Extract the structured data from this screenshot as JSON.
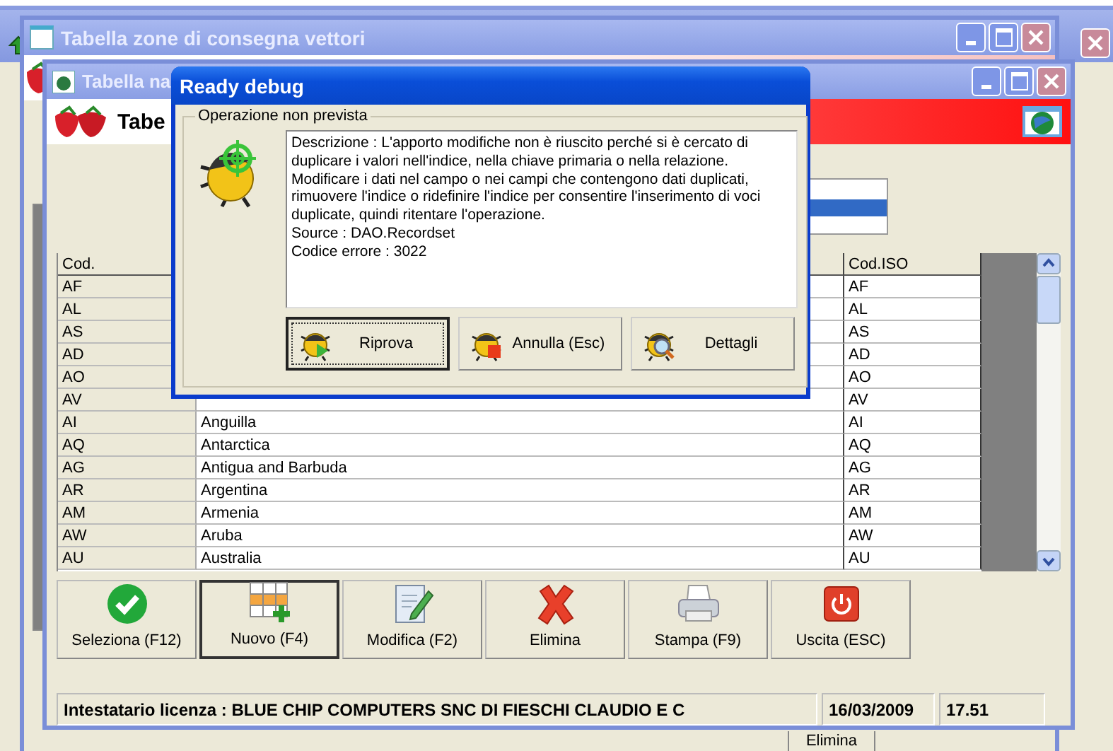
{
  "back_window": {
    "button_label": "Elimina"
  },
  "middle_window": {
    "title": "Tabella zone di consegna vettori"
  },
  "window": {
    "title": "Tabella na",
    "header_title": "Tabe"
  },
  "list_rows": [
    {
      "selected": false
    },
    {
      "selected": true
    },
    {
      "selected": false
    }
  ],
  "table": {
    "columns": [
      "Cod.",
      "Cod.ISO"
    ],
    "rows": [
      {
        "code": "AF",
        "iso": "AF"
      },
      {
        "code": "AL",
        "iso": "AL"
      },
      {
        "code": "AS",
        "iso": "AS"
      },
      {
        "code": "AD",
        "iso": "AD"
      },
      {
        "code": "AO",
        "iso": "AO"
      },
      {
        "code": "AV",
        "iso": "AV"
      },
      {
        "code": "AI",
        "name": "Anguilla",
        "iso": "AI"
      },
      {
        "code": "AQ",
        "name": "Antarctica",
        "iso": "AQ"
      },
      {
        "code": "AG",
        "name": "Antigua and Barbuda",
        "iso": "AG"
      },
      {
        "code": "AR",
        "name": "Argentina",
        "iso": "AR"
      },
      {
        "code": "AM",
        "name": "Armenia",
        "iso": "AM"
      },
      {
        "code": "AW",
        "name": "Aruba",
        "iso": "AW"
      },
      {
        "code": "AU",
        "name": "Australia",
        "iso": "AU"
      }
    ]
  },
  "toolbar": [
    {
      "label": "Seleziona (F12)",
      "focused": false
    },
    {
      "label": "Nuovo (F4)",
      "focused": true
    },
    {
      "label": "Modifica (F2)",
      "focused": false
    },
    {
      "label": "Elimina",
      "focused": false
    },
    {
      "label": "Stampa (F9)",
      "focused": false
    },
    {
      "label": "Uscita (ESC)",
      "focused": false
    }
  ],
  "status_bar": {
    "license": "Intestatario licenza : BLUE CHIP COMPUTERS SNC DI FIESCHI CLAUDIO E C",
    "date": "16/03/2009",
    "time": "17.51"
  },
  "dialog": {
    "title": "Ready debug",
    "group": "Operazione non prevista",
    "message_lines": [
      "Descrizione : L'apporto modifiche non è riuscito perché si è cercato di",
      "duplicare i valori nell'indice, nella chiave primaria o nella relazione.",
      "Modificare i dati nel campo o nei campi che contengono dati duplicati,",
      "rimuovere l'indice o ridefinire l'indice per consentire l'inserimento di voci",
      "duplicate, quindi ritentare l'operazione.",
      "Source : DAO.Recordset",
      "Codice errore : 3022"
    ],
    "buttons": [
      {
        "label": "Riprova",
        "focused": true
      },
      {
        "label": "Annulla (Esc)",
        "focused": false
      },
      {
        "label": "Dettagli",
        "focused": false
      }
    ]
  }
}
